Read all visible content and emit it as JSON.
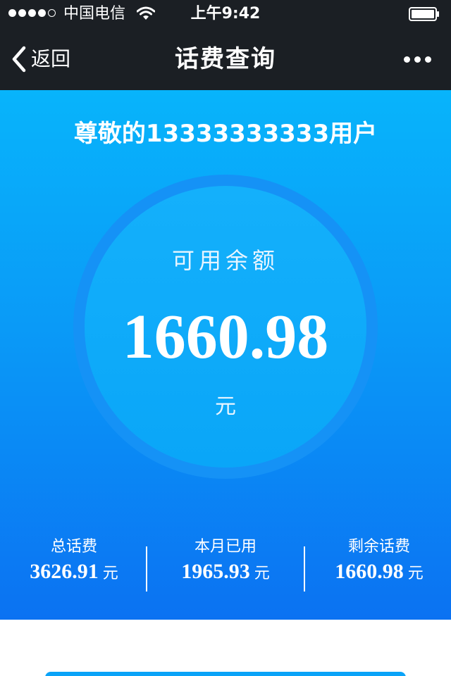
{
  "status_bar": {
    "carrier": "中国电信",
    "time": "上午9:42"
  },
  "nav": {
    "back_label": "返回",
    "title": "话费查询"
  },
  "balance": {
    "greeting": "尊敬的13333333333用户",
    "label": "可用余额",
    "amount": "1660.98",
    "unit": "元"
  },
  "summary": [
    {
      "label": "总话费",
      "value": "3626.91",
      "unit": "元"
    },
    {
      "label": "本月已用",
      "value": "1965.93",
      "unit": "元"
    },
    {
      "label": "剩余话费",
      "value": "1660.98",
      "unit": "元"
    }
  ],
  "icons": {
    "signal": "signal-dots-icon",
    "wifi": "wifi-icon",
    "battery": "battery-icon",
    "back": "chevron-left-icon",
    "more": "more-dots-icon"
  },
  "colors": {
    "nav_background": "#1b1f24",
    "panel_gradient_top": "#08b4fb",
    "panel_gradient_bottom": "#0b72f2",
    "text": "#ffffff"
  }
}
